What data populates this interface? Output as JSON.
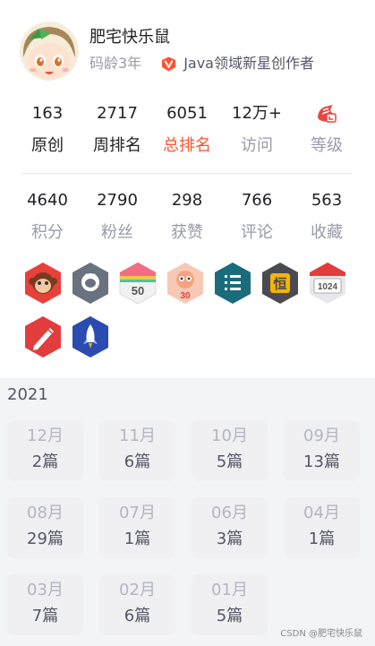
{
  "profile": {
    "username": "肥宅快乐鼠",
    "code_age": "码龄3年",
    "cert_icon": "verified-v-icon",
    "cert_text": "Java领域新星创作者"
  },
  "stats_row1": [
    {
      "value": "163",
      "label": "原创",
      "style": "dark"
    },
    {
      "value": "2717",
      "label": "周排名",
      "style": "dark"
    },
    {
      "value": "6051",
      "label": "总排名",
      "style": "red"
    },
    {
      "value": "12万+",
      "label": "访问",
      "style": "grey"
    },
    {
      "value": "",
      "label": "等级",
      "style": "grey",
      "icon": "level-icon"
    }
  ],
  "stats_row2": [
    {
      "value": "4640",
      "label": "积分"
    },
    {
      "value": "2790",
      "label": "粉丝"
    },
    {
      "value": "298",
      "label": "获赞"
    },
    {
      "value": "766",
      "label": "评论"
    },
    {
      "value": "563",
      "label": "收藏"
    }
  ],
  "badges": [
    {
      "name": "monkey-badge-icon",
      "color": "#e8403a"
    },
    {
      "name": "github-badge-icon",
      "color": "#6a7280"
    },
    {
      "name": "fifty-days-badge-icon",
      "text": "50",
      "color": "#eeeeee"
    },
    {
      "name": "thirty-days-badge-icon",
      "text": "30",
      "color": "#f7c9b5"
    },
    {
      "name": "list-badge-icon",
      "color": "#1a6c7a"
    },
    {
      "name": "persevere-badge-icon",
      "text": "恒",
      "color": "#4a4a52"
    },
    {
      "name": "1024-badge-icon",
      "text": "1024",
      "color": "#e8e8ec"
    },
    {
      "name": "pen-badge-icon",
      "color": "#e23c3c"
    },
    {
      "name": "rocket-badge-icon",
      "color": "#2a4bb0"
    }
  ],
  "archive": {
    "year": "2021",
    "months": [
      {
        "month": "12月",
        "count": "2篇"
      },
      {
        "month": "11月",
        "count": "6篇"
      },
      {
        "month": "10月",
        "count": "5篇"
      },
      {
        "month": "09月",
        "count": "13篇"
      },
      {
        "month": "08月",
        "count": "29篇"
      },
      {
        "month": "07月",
        "count": "1篇"
      },
      {
        "month": "06月",
        "count": "3篇"
      },
      {
        "month": "04月",
        "count": "1篇"
      },
      {
        "month": "03月",
        "count": "7篇"
      },
      {
        "month": "02月",
        "count": "6篇"
      },
      {
        "month": "01月",
        "count": "5篇"
      }
    ]
  },
  "footer": "CSDN @肥宅快乐鼠"
}
